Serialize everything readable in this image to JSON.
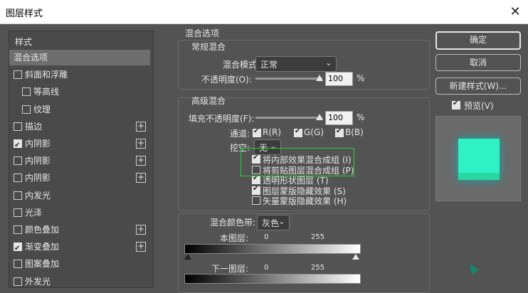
{
  "window": {
    "title": "图层样式",
    "close_glyph": "✕"
  },
  "left_list": {
    "header": "样式",
    "items": [
      {
        "label": "混合选项",
        "selected": true,
        "checkbox": false,
        "checked": false,
        "plus": false
      },
      {
        "label": "斜面和浮雕",
        "checkbox": true,
        "checked": false,
        "plus": false
      },
      {
        "label": "等高线",
        "checkbox": true,
        "checked": false,
        "plus": false,
        "indent": true
      },
      {
        "label": "纹理",
        "checkbox": true,
        "checked": false,
        "plus": false,
        "indent": true
      },
      {
        "label": "描边",
        "checkbox": true,
        "checked": false,
        "plus": true
      },
      {
        "label": "内阴影",
        "checkbox": true,
        "checked": true,
        "plus": true
      },
      {
        "label": "内阴影",
        "checkbox": true,
        "checked": false,
        "plus": true
      },
      {
        "label": "内阴影",
        "checkbox": true,
        "checked": false,
        "plus": true
      },
      {
        "label": "内发光",
        "checkbox": true,
        "checked": false,
        "plus": false
      },
      {
        "label": "光泽",
        "checkbox": true,
        "checked": false,
        "plus": false
      },
      {
        "label": "颜色叠加",
        "checkbox": true,
        "checked": false,
        "plus": true
      },
      {
        "label": "渐变叠加",
        "checkbox": true,
        "checked": true,
        "plus": true
      },
      {
        "label": "图案叠加",
        "checkbox": true,
        "checked": false,
        "plus": false
      },
      {
        "label": "外发光",
        "checkbox": true,
        "checked": false,
        "plus": false
      }
    ]
  },
  "blend_options": {
    "title": "混合选项",
    "general": {
      "title": "常规混合",
      "mode_label": "混合模式:",
      "mode_value": "正常",
      "opacity_label": "不透明度(O):",
      "opacity_value": "100",
      "percent": "%"
    },
    "advanced": {
      "title": "高级混合",
      "fill_opacity_label": "填充不透明度(F):",
      "fill_opacity_value": "100",
      "percent": "%",
      "channels_label": "通道:",
      "channels": [
        "R(R)",
        "G(G)",
        "B(B)"
      ],
      "knockout_label": "挖空:",
      "knockout_value": "无",
      "options": [
        {
          "label": "将内部效果混合成组 (I)",
          "checked": true
        },
        {
          "label": "将剪贴图层混合成组 (P)",
          "checked": false
        },
        {
          "label": "透明形状图层 (T)",
          "checked": true
        },
        {
          "label": "图层蒙版隐藏效果 (S)",
          "checked": true
        },
        {
          "label": "矢量蒙版隐藏效果 (H)",
          "checked": false
        }
      ]
    },
    "blend_if": {
      "label": "混合颜色带:",
      "value": "灰色",
      "this_layer": "本图层:",
      "underlying_layer": "下一图层:",
      "min": "0",
      "max": "255"
    }
  },
  "buttons": {
    "ok": "确定",
    "cancel": "取消",
    "new_style": "新建样式(W)...",
    "preview": "预览(V)"
  },
  "preview": {
    "square_color": "#2ef2c4",
    "highlight_color": "#2ecc40"
  }
}
